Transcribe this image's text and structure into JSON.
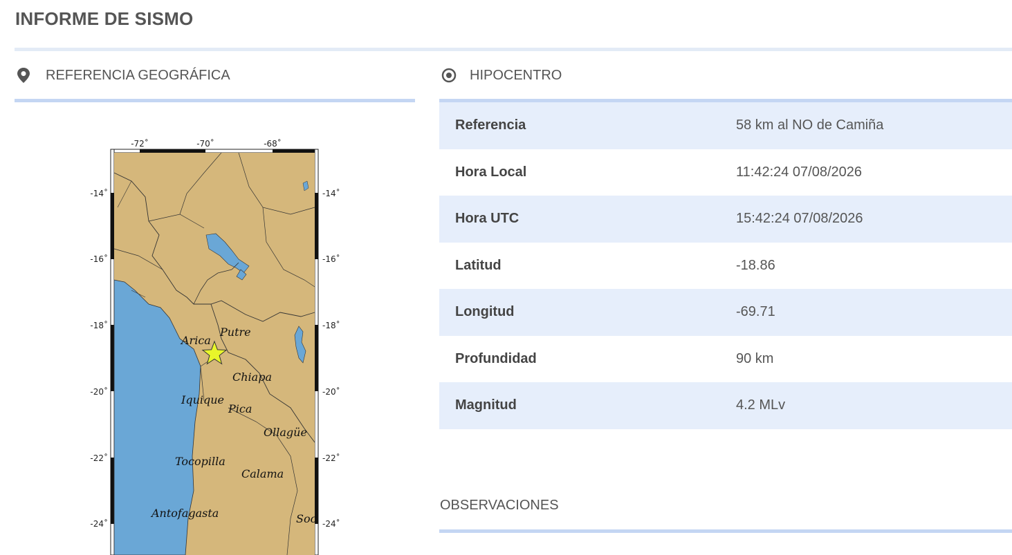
{
  "page_title": "INFORME DE SISMO",
  "geo": {
    "title": "REFERENCIA GEOGRÁFICA",
    "icon": "map-pin-icon"
  },
  "hypo": {
    "title": "HIPOCENTRO",
    "icon": "target-icon",
    "rows": [
      {
        "label": "Referencia",
        "value": "58 km al NO de Camiña"
      },
      {
        "label": "Hora Local",
        "value": "11:42:24 07/08/2026"
      },
      {
        "label": "Hora UTC",
        "value": "15:42:24 07/08/2026"
      },
      {
        "label": "Latitud",
        "value": "-18.86"
      },
      {
        "label": "Longitud",
        "value": "-69.71"
      },
      {
        "label": "Profundidad",
        "value": "90 km"
      },
      {
        "label": "Magnitud",
        "value": "4.2 MLv"
      }
    ]
  },
  "observations": {
    "title": "OBSERVACIONES"
  },
  "map": {
    "lon_ticks": [
      "-72˚",
      "-70˚",
      "-68˚"
    ],
    "lat_ticks": [
      "-14˚",
      "-16˚",
      "-18˚",
      "-20˚",
      "-22˚",
      "-24˚"
    ],
    "places": [
      "Arica",
      "Putre",
      "Chiapa",
      "Iquique",
      "Pica",
      "Ollagüe",
      "Tocopilla",
      "Calama",
      "Antofagasta",
      "Soc"
    ],
    "colors": {
      "land": "#d5b77b",
      "sea": "#6aa7d6",
      "star": "#e8f52a"
    }
  }
}
